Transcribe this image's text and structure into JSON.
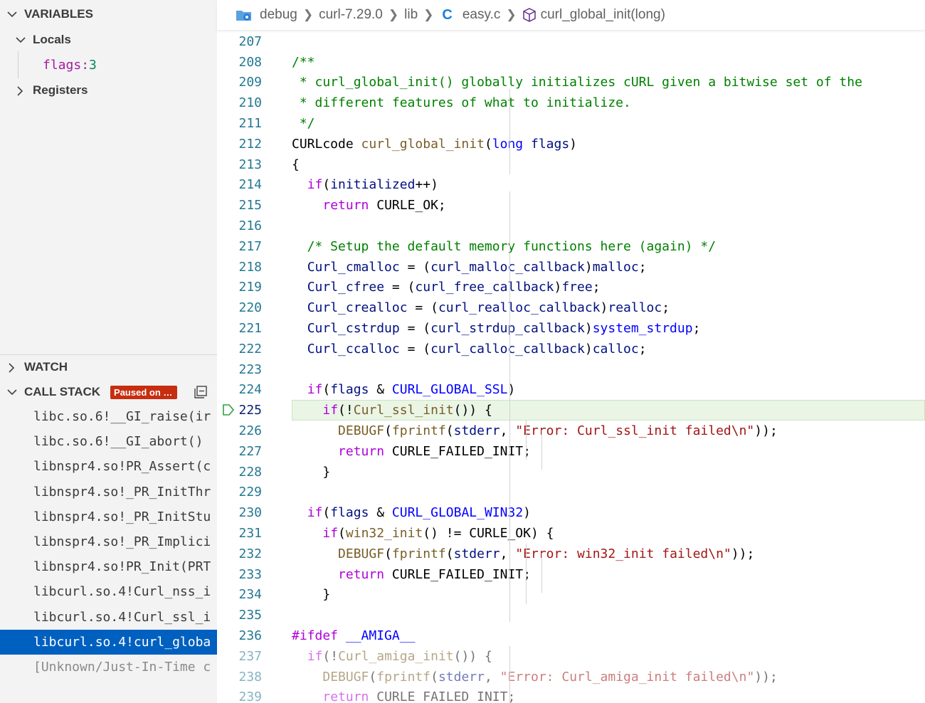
{
  "sidebar": {
    "variables_header": "VARIABLES",
    "locals_label": "Locals",
    "local_var": {
      "name": "flags",
      "sep": ": ",
      "value": "3"
    },
    "registers_label": "Registers",
    "watch_header": "WATCH",
    "callstack_header": "CALL STACK",
    "paused_badge": "Paused on e...",
    "frames": [
      "libc.so.6!__GI_raise(ir",
      "libc.so.6!__GI_abort()",
      "libnspr4.so!PR_Assert(c",
      "libnspr4.so!_PR_InitThr",
      "libnspr4.so!_PR_InitStu",
      "libnspr4.so!_PR_Implici",
      "libnspr4.so!PR_Init(PRT",
      "libcurl.so.4!Curl_nss_i",
      "libcurl.so.4!Curl_ssl_i",
      "libcurl.so.4!curl_globa",
      "[Unknown/Just-In-Time c"
    ],
    "selected_frame": 9
  },
  "breadcrumb": {
    "items": [
      "debug",
      "curl-7.29.0",
      "lib",
      "easy.c",
      "curl_global_init(long)"
    ]
  },
  "editor": {
    "current_line": "225",
    "lines": [
      {
        "n": "207",
        "t": [
          [
            ""
          ]
        ]
      },
      {
        "n": "208",
        "t": [
          [
            "/**",
            "cm"
          ]
        ]
      },
      {
        "n": "209",
        "t": [
          [
            " * curl_global_init() globally initializes cURL given a bitwise set of the",
            "cm"
          ]
        ]
      },
      {
        "n": "210",
        "t": [
          [
            " * different features of what to initialize.",
            "cm"
          ]
        ]
      },
      {
        "n": "211",
        "t": [
          [
            " */",
            "cm"
          ]
        ]
      },
      {
        "n": "212",
        "t": [
          [
            "CURLcode ",
            "plain"
          ],
          [
            "curl_global_init",
            "fn"
          ],
          [
            "(",
            "plain"
          ],
          [
            "long",
            "kw2"
          ],
          [
            " ",
            "plain"
          ],
          [
            "flags",
            "var"
          ],
          [
            ")",
            "plain"
          ]
        ]
      },
      {
        "n": "213",
        "t": [
          [
            "{",
            "plain"
          ]
        ]
      },
      {
        "n": "214",
        "t": [
          [
            "  ",
            "plain"
          ],
          [
            "if",
            "kw"
          ],
          [
            "(",
            "plain"
          ],
          [
            "initialized",
            "var"
          ],
          [
            "++)",
            "plain"
          ]
        ]
      },
      {
        "n": "215",
        "t": [
          [
            "    ",
            "plain"
          ],
          [
            "return",
            "kw"
          ],
          [
            " CURLE_OK;",
            "plain"
          ]
        ]
      },
      {
        "n": "216",
        "t": [
          [
            ""
          ]
        ]
      },
      {
        "n": "217",
        "t": [
          [
            "  /* Setup the default memory functions here (again) */",
            "cm"
          ]
        ]
      },
      {
        "n": "218",
        "t": [
          [
            "  ",
            "plain"
          ],
          [
            "Curl_cmalloc",
            "var"
          ],
          [
            " = (",
            "plain"
          ],
          [
            "curl_malloc_callback",
            "var"
          ],
          [
            ")",
            "plain"
          ],
          [
            "malloc",
            "var"
          ],
          [
            ";",
            "plain"
          ]
        ]
      },
      {
        "n": "219",
        "t": [
          [
            "  ",
            "plain"
          ],
          [
            "Curl_cfree",
            "var"
          ],
          [
            " = (",
            "plain"
          ],
          [
            "curl_free_callback",
            "var"
          ],
          [
            ")",
            "plain"
          ],
          [
            "free",
            "var"
          ],
          [
            ";",
            "plain"
          ]
        ]
      },
      {
        "n": "220",
        "t": [
          [
            "  ",
            "plain"
          ],
          [
            "Curl_crealloc",
            "var"
          ],
          [
            " = (",
            "plain"
          ],
          [
            "curl_realloc_callback",
            "var"
          ],
          [
            ")",
            "plain"
          ],
          [
            "realloc",
            "var"
          ],
          [
            ";",
            "plain"
          ]
        ]
      },
      {
        "n": "221",
        "t": [
          [
            "  ",
            "plain"
          ],
          [
            "Curl_cstrdup",
            "var"
          ],
          [
            " = (",
            "plain"
          ],
          [
            "curl_strdup_callback",
            "var"
          ],
          [
            ")",
            "plain"
          ],
          [
            "system_strdup",
            "mac"
          ],
          [
            ";",
            "plain"
          ]
        ]
      },
      {
        "n": "222",
        "t": [
          [
            "  ",
            "plain"
          ],
          [
            "Curl_ccalloc",
            "var"
          ],
          [
            " = (",
            "plain"
          ],
          [
            "curl_calloc_callback",
            "var"
          ],
          [
            ")",
            "plain"
          ],
          [
            "calloc",
            "var"
          ],
          [
            ";",
            "plain"
          ]
        ]
      },
      {
        "n": "223",
        "t": [
          [
            ""
          ]
        ]
      },
      {
        "n": "224",
        "t": [
          [
            "  ",
            "plain"
          ],
          [
            "if",
            "kw"
          ],
          [
            "(",
            "plain"
          ],
          [
            "flags",
            "var"
          ],
          [
            " & ",
            "plain"
          ],
          [
            "CURL_GLOBAL_SSL",
            "mac"
          ],
          [
            ")",
            "plain"
          ]
        ]
      },
      {
        "n": "225",
        "t": [
          [
            "    ",
            "plain"
          ],
          [
            "if",
            "kw"
          ],
          [
            "(!",
            "plain"
          ],
          [
            "Curl_ssl_init",
            "fn"
          ],
          [
            "()) {",
            "plain"
          ]
        ]
      },
      {
        "n": "226",
        "t": [
          [
            "      ",
            "plain"
          ],
          [
            "DEBUGF",
            "fn"
          ],
          [
            "(",
            "plain"
          ],
          [
            "fprintf",
            "fn"
          ],
          [
            "(",
            "plain"
          ],
          [
            "stderr",
            "var"
          ],
          [
            ", ",
            "plain"
          ],
          [
            "\"Error: Curl_ssl_init failed\\n\"",
            "str"
          ],
          [
            "));",
            "plain"
          ]
        ]
      },
      {
        "n": "227",
        "t": [
          [
            "      ",
            "plain"
          ],
          [
            "return",
            "kw"
          ],
          [
            " CURLE_FAILED_INIT;",
            "plain"
          ]
        ]
      },
      {
        "n": "228",
        "t": [
          [
            "    }",
            "plain"
          ]
        ]
      },
      {
        "n": "229",
        "t": [
          [
            ""
          ]
        ]
      },
      {
        "n": "230",
        "t": [
          [
            "  ",
            "plain"
          ],
          [
            "if",
            "kw"
          ],
          [
            "(",
            "plain"
          ],
          [
            "flags",
            "var"
          ],
          [
            " & ",
            "plain"
          ],
          [
            "CURL_GLOBAL_WIN32",
            "mac"
          ],
          [
            ")",
            "plain"
          ]
        ]
      },
      {
        "n": "231",
        "t": [
          [
            "    ",
            "plain"
          ],
          [
            "if",
            "kw"
          ],
          [
            "(",
            "plain"
          ],
          [
            "win32_init",
            "fn"
          ],
          [
            "() != CURLE_OK) {",
            "plain"
          ]
        ]
      },
      {
        "n": "232",
        "t": [
          [
            "      ",
            "plain"
          ],
          [
            "DEBUGF",
            "fn"
          ],
          [
            "(",
            "plain"
          ],
          [
            "fprintf",
            "fn"
          ],
          [
            "(",
            "plain"
          ],
          [
            "stderr",
            "var"
          ],
          [
            ", ",
            "plain"
          ],
          [
            "\"Error: win32_init failed\\n\"",
            "str"
          ],
          [
            "));",
            "plain"
          ]
        ]
      },
      {
        "n": "233",
        "t": [
          [
            "      ",
            "plain"
          ],
          [
            "return",
            "kw"
          ],
          [
            " CURLE_FAILED_INIT;",
            "plain"
          ]
        ]
      },
      {
        "n": "234",
        "t": [
          [
            "    }",
            "plain"
          ]
        ]
      },
      {
        "n": "235",
        "t": [
          [
            ""
          ]
        ]
      },
      {
        "n": "236",
        "t": [
          [
            "#ifdef",
            "pp"
          ],
          [
            " ",
            "plain"
          ],
          [
            "__AMIGA__",
            "mac"
          ]
        ]
      },
      {
        "n": "237",
        "f": true,
        "t": [
          [
            "  ",
            "plain"
          ],
          [
            "if",
            "kw"
          ],
          [
            "(!",
            "plain"
          ],
          [
            "Curl_amiga_init",
            "fn"
          ],
          [
            "()) {",
            "plain"
          ]
        ]
      },
      {
        "n": "238",
        "f": true,
        "t": [
          [
            "    ",
            "plain"
          ],
          [
            "DEBUGF",
            "fn"
          ],
          [
            "(",
            "plain"
          ],
          [
            "fprintf",
            "fn"
          ],
          [
            "(",
            "plain"
          ],
          [
            "stderr",
            "var"
          ],
          [
            ", ",
            "plain"
          ],
          [
            "\"Error: Curl_amiga_init failed\\n\"",
            "str"
          ],
          [
            "));",
            "plain"
          ]
        ]
      },
      {
        "n": "239",
        "f": true,
        "t": [
          [
            "    ",
            "plain"
          ],
          [
            "return",
            "kw"
          ],
          [
            " CURLE_FAILED_INIT;",
            "plain"
          ]
        ]
      }
    ]
  }
}
